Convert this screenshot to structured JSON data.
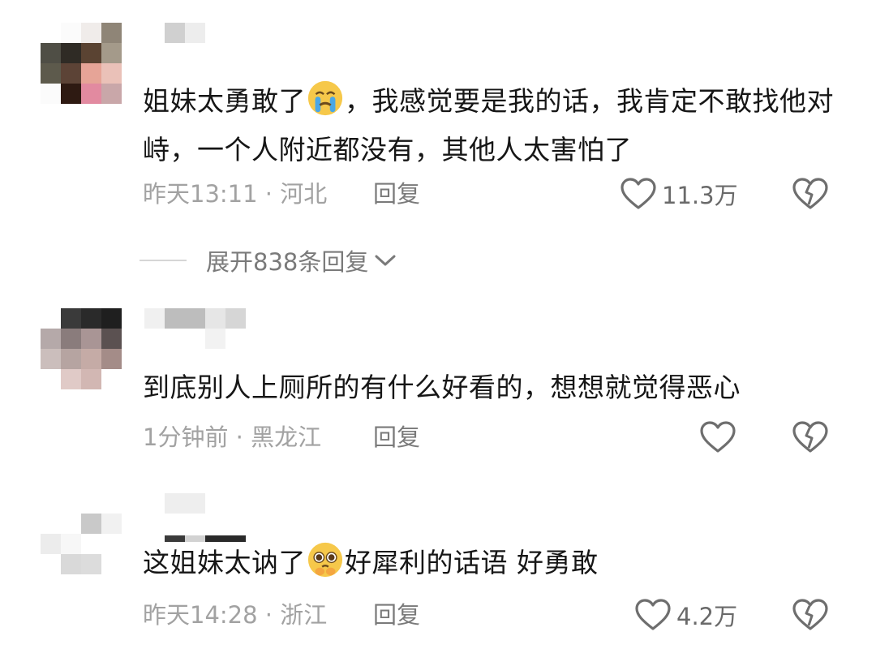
{
  "comments": [
    {
      "text_before_emoji": "姐妹太勇敢了",
      "emoji": "crying-emoji",
      "text_after_emoji": "，我感觉要是我的话，我肯定不敢找他对峙，一个人附近都没有，其他人太害怕了",
      "meta": "昨天13:11 · 河北",
      "reply_label": "回复",
      "like_count": "11.3万",
      "expand_label": "展开838条回复"
    },
    {
      "text": "到底别人上厕所的有什么好看的，想想就觉得恶心",
      "meta": "1分钟前 · 黑龙江",
      "reply_label": "回复",
      "like_count": ""
    },
    {
      "text_before_emoji": "这姐妹太讷了",
      "emoji": "pleading-emoji",
      "text_after_emoji": "好犀利的话语 好勇敢",
      "meta": "昨天14:28 · 浙江",
      "reply_label": "回复",
      "like_count": "4.2万"
    }
  ],
  "colors": {
    "text": "#161616",
    "meta": "#a2a2a2",
    "action": "#7a7a7a",
    "icon": "#6e6e6e"
  }
}
